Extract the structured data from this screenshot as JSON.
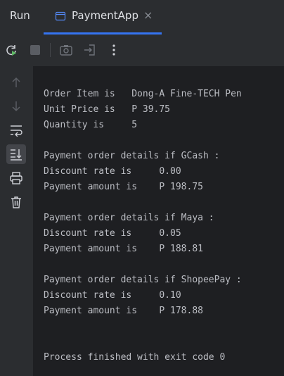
{
  "tabbar": {
    "run_label": "Run",
    "tab_title": "PaymentApp",
    "tab_close": "×"
  },
  "toolbar": {
    "buttons": [
      "rerun-icon",
      "stop-icon",
      "camera-icon",
      "restore-layout-icon",
      "more-options-icon"
    ]
  },
  "sidebar": {
    "buttons": [
      "up-arrow-icon",
      "down-arrow-icon",
      "soft-wrap-icon",
      "scroll-to-end-icon",
      "print-icon",
      "trash-icon"
    ]
  },
  "console": {
    "lines": [
      ".",
      "",
      "Order Item is   Dong-A Fine-TECH Pen",
      "Unit Price is   P 39.75",
      "Quantity is     5",
      "",
      "Payment order details if GCash :",
      "Discount rate is     0.00",
      "Payment amount is    P 198.75",
      "",
      "Payment order details if Maya :",
      "Discount rate is     0.05",
      "Payment amount is    P 188.81",
      "",
      "Payment order details if ShopeePay :",
      "Discount rate is     0.10",
      "Payment amount is    P 178.88",
      "",
      "",
      "Process finished with exit code 0"
    ]
  },
  "colors": {
    "accent": "#3574f0",
    "panel_bg": "#2b2d30",
    "console_bg": "#1e1f22",
    "rerun_green": "#5fb865"
  }
}
